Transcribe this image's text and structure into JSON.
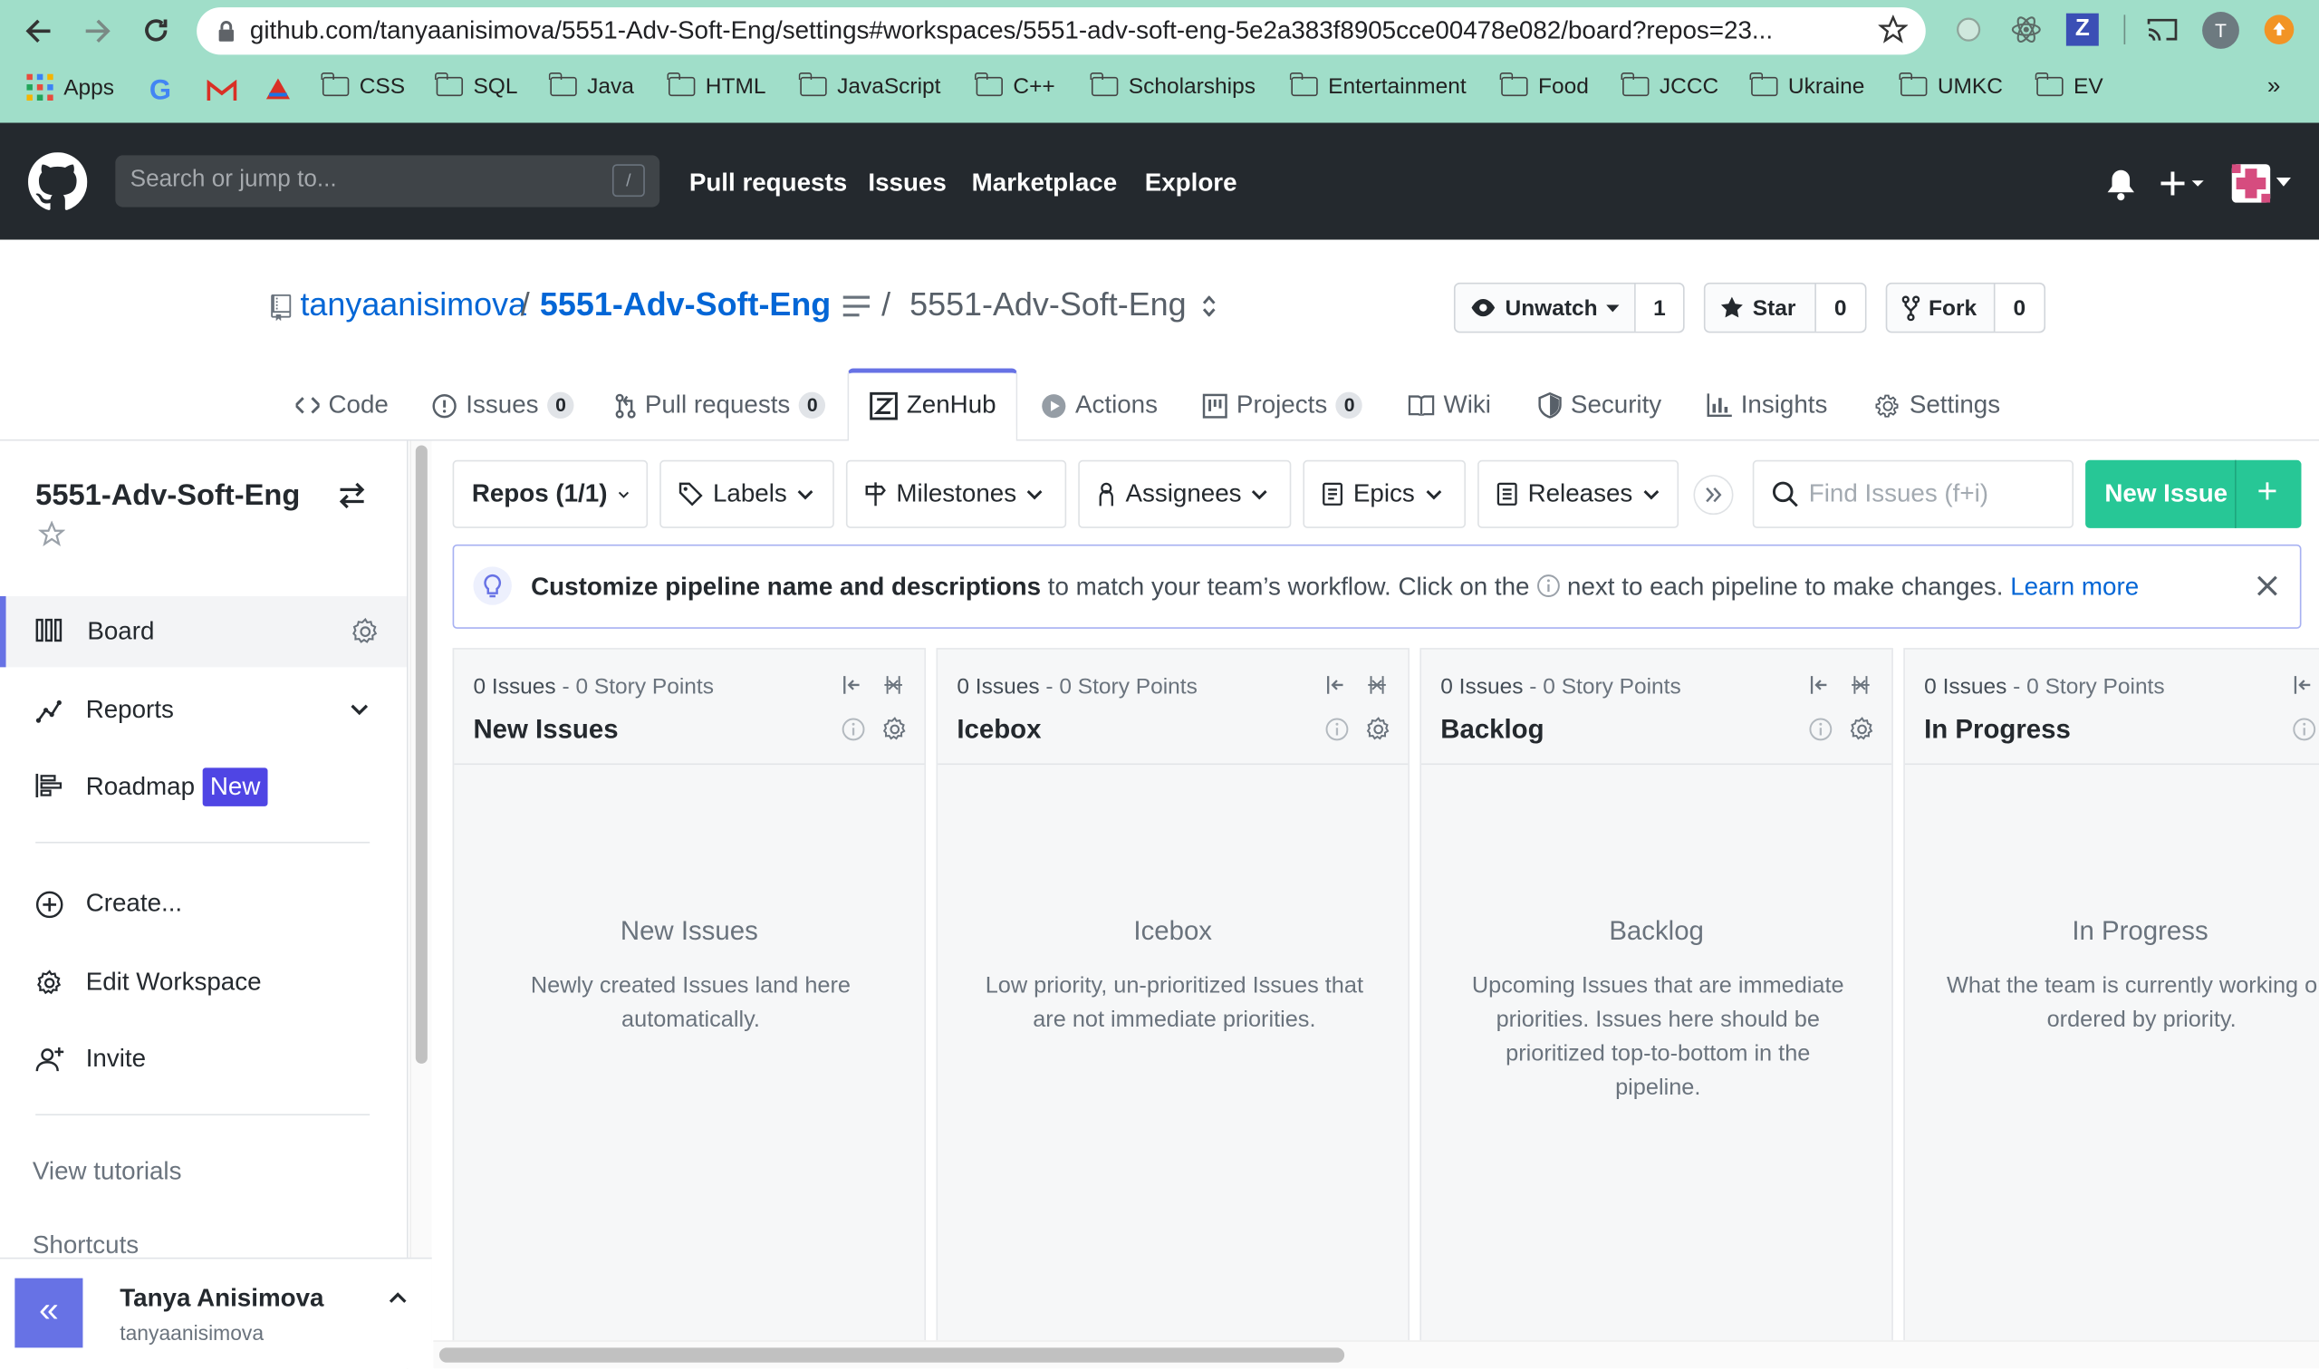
{
  "browser": {
    "url": "github.com/tanyaanisimova/5551-Adv-Soft-Eng/settings#workspaces/5551-adv-soft-eng-5e2a383f8905cce00478e082/board?repos=23...",
    "profile_initial": "T",
    "bookmarks": [
      "Apps",
      "CSS",
      "SQL",
      "Java",
      "HTML",
      "JavaScript",
      "C++",
      "Scholarships",
      "Entertainment",
      "Food",
      "JCCC",
      "Ukraine",
      "UMKC",
      "EV"
    ],
    "bookmarks_more": "»"
  },
  "github": {
    "search_placeholder": "Search or jump to...",
    "search_key": "/",
    "nav": [
      "Pull requests",
      "Issues",
      "Marketplace",
      "Explore"
    ]
  },
  "repo": {
    "owner": "tanyaanisimova",
    "sep": "/",
    "name": "5551-Adv-Soft-Eng",
    "sep2": "/",
    "workspace": "5551-Adv-Soft-Eng",
    "unwatch_label": "Unwatch",
    "watch_count": "1",
    "star_label": "Star",
    "star_count": "0",
    "fork_label": "Fork",
    "fork_count": "0"
  },
  "tabs": [
    {
      "label": "Code"
    },
    {
      "label": "Issues",
      "count": "0"
    },
    {
      "label": "Pull requests",
      "count": "0"
    },
    {
      "label": "ZenHub"
    },
    {
      "label": "Actions"
    },
    {
      "label": "Projects",
      "count": "0"
    },
    {
      "label": "Wiki"
    },
    {
      "label": "Security"
    },
    {
      "label": "Insights"
    },
    {
      "label": "Settings"
    }
  ],
  "sidebar": {
    "workspace_title": "5551-Adv-Soft-Eng",
    "board": "Board",
    "reports": "Reports",
    "roadmap": "Roadmap",
    "roadmap_badge": "New",
    "create": "Create...",
    "edit_workspace": "Edit Workspace",
    "invite": "Invite",
    "view_tutorials": "View tutorials",
    "shortcuts": "Shortcuts",
    "collapse": "«",
    "user_name": "Tanya Anisimova",
    "user_login": "tanyaanisimova"
  },
  "filters": {
    "repos": "Repos (1/1)",
    "labels": "Labels",
    "milestones": "Milestones",
    "assignees": "Assignees",
    "epics": "Epics",
    "releases": "Releases",
    "find_placeholder": "Find Issues (f+i)",
    "new_issue": "New Issue",
    "new_plus": "+"
  },
  "banner": {
    "bold": "Customize pipeline name and descriptions",
    "text1": " to match your team’s workflow. Click on the ",
    "text2": " next to each pipeline to make changes. ",
    "link": "Learn more"
  },
  "pipelines": [
    {
      "issues": "0 Issues",
      "points": "0 Story Points",
      "name": "New Issues",
      "empty_title": "New Issues",
      "empty_desc": "Newly created Issues land here automatically."
    },
    {
      "issues": "0 Issues",
      "points": "0 Story Points",
      "name": "Icebox",
      "empty_title": "Icebox",
      "empty_desc": "Low priority, un-prioritized Issues that are not immediate priorities."
    },
    {
      "issues": "0 Issues",
      "points": "0 Story Points",
      "name": "Backlog",
      "empty_title": "Backlog",
      "empty_desc": "Upcoming Issues that are immediate priorities. Issues here should be prioritized top-to-bottom in the pipeline."
    },
    {
      "issues": "0 Issues",
      "points": "0 Story Points",
      "name": "In Progress",
      "empty_title": "In Progress",
      "empty_desc": "What the team is currently working on, ordered by priority."
    }
  ],
  "pipeline_sep": " - ",
  "colors": {
    "zenhub_purple": "#6772e5",
    "new_issue_green": "#27c796",
    "link_blue": "#0366d6",
    "github_dark": "#24292e",
    "chrome_bar": "#a0dec9"
  }
}
